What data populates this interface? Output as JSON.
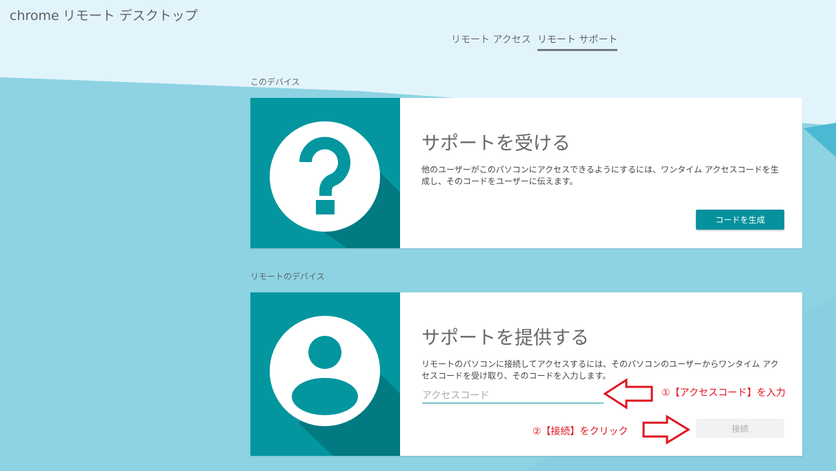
{
  "header": {
    "brand": "chrome",
    "title": "リモート デスクトップ"
  },
  "tabs": [
    {
      "label": "リモート アクセス",
      "active": false
    },
    {
      "label": "リモート サポート",
      "active": true
    }
  ],
  "sections": {
    "this_device_label": "このデバイス",
    "remote_device_label": "リモートのデバイス"
  },
  "get_support": {
    "icon": "question-mark-icon",
    "title": "サポートを受ける",
    "description": "他のユーザーがこのパソコンにアクセスできるようにするには、ワンタイム アクセスコードを生成し、そのコードをユーザーに伝えます。",
    "button_label": "コードを生成"
  },
  "give_support": {
    "icon": "person-icon",
    "title": "サポートを提供する",
    "description": "リモートのパソコンに接続してアクセスするには、そのパソコンのユーザーからワンタイム アクセスコードを受け取り、そのコードを入力します。",
    "input_value": "",
    "input_placeholder": "アクセスコード",
    "connect_label": "接続"
  },
  "annotations": {
    "step1": "①【アクセスコード】を入力",
    "step2": "②【接続】をクリック",
    "arrow_color": "#e0141f"
  },
  "colors": {
    "accent": "#03969f",
    "accent_dark": "#027a82",
    "background_top": "#e2f4fb",
    "background_bottom": "#8dd2e3"
  }
}
